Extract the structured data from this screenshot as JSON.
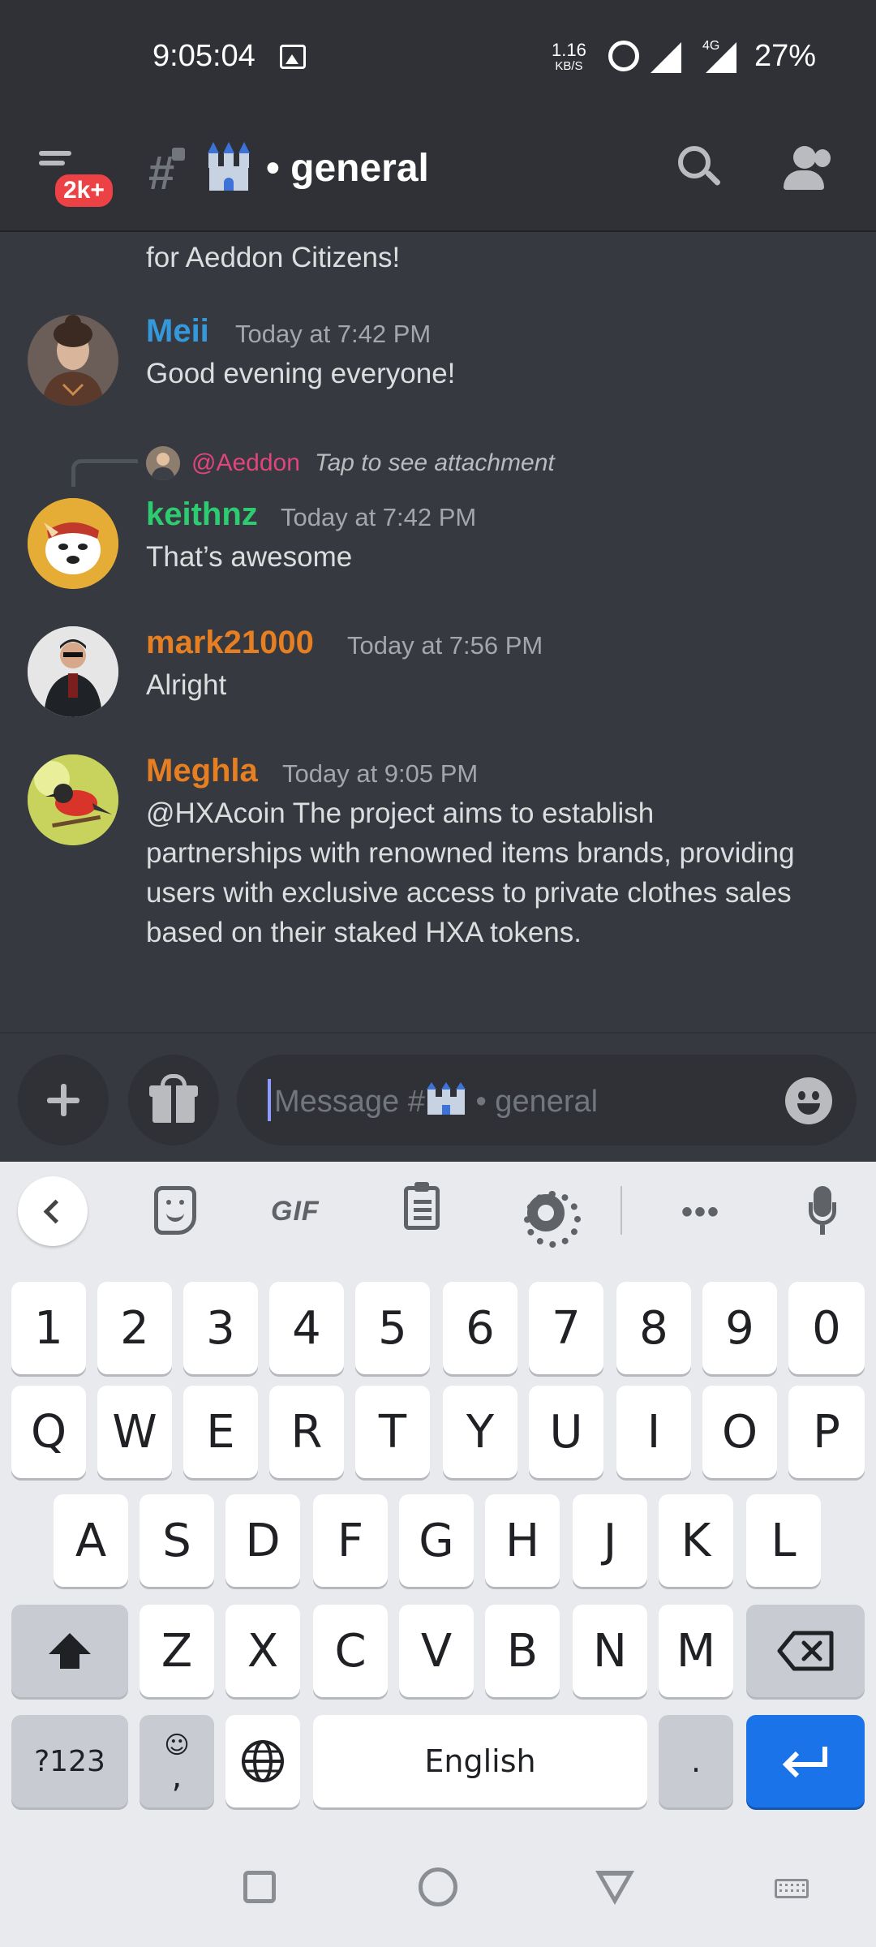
{
  "status_bar": {
    "time": "9:05:04",
    "net_speed": "1.16",
    "net_unit": "KB/S",
    "network": "4G",
    "battery": "27%"
  },
  "header": {
    "badge": "2k+",
    "channel_prefix": "#",
    "channel_name": "• general",
    "icons": [
      "hamburger-menu-icon",
      "locked-channel-icon",
      "castle-emoji",
      "search-icon",
      "members-icon"
    ]
  },
  "messages": {
    "continued_text": "for Aeddon Citizens!",
    "items": [
      {
        "author": "Meii",
        "author_color": "#3498db",
        "timestamp": "Today at 7:42 PM",
        "content": "Good evening everyone!"
      },
      {
        "reply_to": "@Aeddon",
        "reply_preview": "Tap to see attachment",
        "author": "keithnz",
        "author_color": "#2ecc71",
        "timestamp": "Today at 7:42 PM",
        "content": "That’s awesome"
      },
      {
        "author": "mark21000",
        "author_color": "#e67e22",
        "timestamp": "Today at 7:56 PM",
        "content": "Alright"
      },
      {
        "author": "Meghla",
        "author_color": "#e67e22",
        "timestamp": "Today at 9:05 PM",
        "content_lines": [
          "@HXAcoin The project aims to establish",
          "partnerships with renowned items brands, providing",
          "users with exclusive access to private clothes sales",
          "based on their staked HXA tokens."
        ]
      }
    ]
  },
  "composer": {
    "placeholder_prefix": "Message #",
    "placeholder_suffix": " • general"
  },
  "keyboard": {
    "toolbar": {
      "gif_label": "GIF",
      "more_label": "•••"
    },
    "row_numbers": [
      "1",
      "2",
      "3",
      "4",
      "5",
      "6",
      "7",
      "8",
      "9",
      "0"
    ],
    "row_q": [
      "Q",
      "W",
      "E",
      "R",
      "T",
      "Y",
      "U",
      "I",
      "O",
      "P"
    ],
    "row_a": [
      "A",
      "S",
      "D",
      "F",
      "G",
      "H",
      "J",
      "K",
      "L"
    ],
    "row_z": [
      "Z",
      "X",
      "C",
      "V",
      "B",
      "N",
      "M"
    ],
    "symbols_key": "?123",
    "emoji_comma_top": "☺",
    "emoji_comma_bottom": ",",
    "space_label": "English",
    "period_key": ".",
    "shift_symbol": "⬆",
    "backspace_symbol": "⌫",
    "enter_symbol": "↵",
    "globe_symbol": "🌐"
  },
  "colors": {
    "background": "#36393f",
    "header_bg": "#2f3136",
    "mention_color": "#e0457b",
    "enter_key": "#1a73e8"
  }
}
